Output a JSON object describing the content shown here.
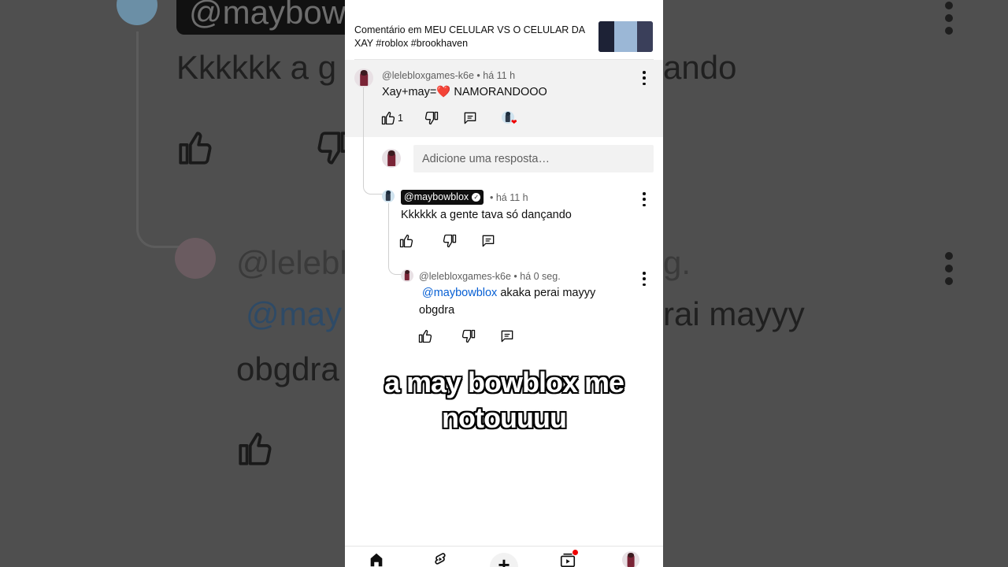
{
  "video": {
    "title": "Comentário em MEU CELULAR VS O CELULAR DA XAY #roblox #brookhaven"
  },
  "comment": {
    "author": "@lelebloxgames-k6e",
    "time": "• há 11 h",
    "text": "Xay+may=❤️ NAMORANDOOO",
    "like_count": "1"
  },
  "reply_input": {
    "placeholder": "Adicione uma resposta…"
  },
  "reply1": {
    "author": "@maybowblox",
    "time": "• há 11 h",
    "text": "Kkkkkk a gente tava só dançando"
  },
  "reply2": {
    "author": "@lelebloxgames-k6e",
    "time": "• há 0 seg.",
    "mention": "@maybowblox",
    "text": " akaka perai mayyy obgdra"
  },
  "caption": {
    "line1": "a may bowblox me",
    "line2": "notouuuu"
  },
  "background": {
    "handle": "@maybowl",
    "reply_text": "Kkkkkk a g",
    "reply_text_end": "ando",
    "author_start": "@leleblo",
    "author_end": "g.",
    "mention": "@may",
    "text_end": "rai mayyy",
    "text_line2": "obgdra"
  },
  "icons": {
    "like": "thumbs-up-icon",
    "dislike": "thumbs-down-icon",
    "reply": "comment-icon",
    "more": "more-vert-icon",
    "nav": [
      "home-icon",
      "shorts-icon",
      "create-icon",
      "subscriptions-icon",
      "profile-avatar"
    ]
  },
  "colors": {
    "mention": "#065fd4",
    "notification": "#ff0000",
    "highlight": "#f2f2f2"
  }
}
